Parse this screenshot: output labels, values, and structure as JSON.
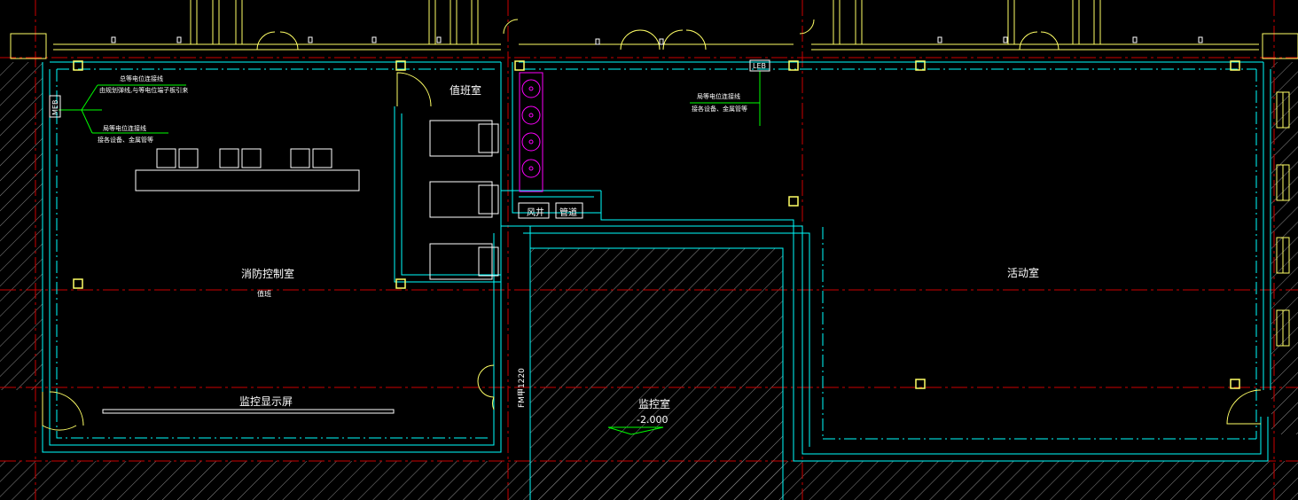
{
  "rooms": {
    "fire_control_room": "消防控制室",
    "fire_control_sub": "值班",
    "duty_room": "值班室",
    "activity_room": "活动室",
    "monitor_room": "监控室",
    "monitor_level": "-2.000",
    "monitor_screen": "监控显示屏"
  },
  "tags": {
    "meb": "MEB",
    "leb": "LEB",
    "vent_shaft": "风井",
    "pipe_shaft": "管道",
    "door_code": "FM甲1220"
  },
  "notes": {
    "meb_note_1": "总等电位连接线",
    "meb_note_2": "由规划弹线,与等电位端子板引来",
    "meb_note_3": "局等电位连接线",
    "meb_note_4": "接各设备、金属管等",
    "leb_note_1": "局等电位连接线",
    "leb_note_2": "接各设备、金属管等"
  },
  "colors": {
    "background": "#000000",
    "wall": "#00ffff",
    "axis": "#cc0000",
    "column": "#ffff66",
    "furniture": "#ffffff",
    "fan": "#ff00ff",
    "note_line": "#00ff00",
    "hatch": "#8a8a8a"
  }
}
